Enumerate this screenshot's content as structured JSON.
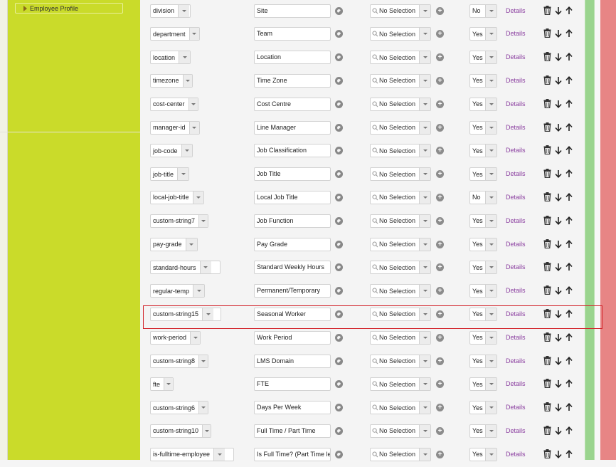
{
  "sidebar": {
    "profile_label": "Employee Profile"
  },
  "rows": [
    {
      "key": "division",
      "label": "Site",
      "picklist": "No Selection",
      "required": "No",
      "details": "Details"
    },
    {
      "key": "department",
      "label": "Team",
      "picklist": "No Selection",
      "required": "Yes",
      "details": "Details"
    },
    {
      "key": "location",
      "label": "Location",
      "picklist": "No Selection",
      "required": "Yes",
      "details": "Details"
    },
    {
      "key": "timezone",
      "label": "Time Zone",
      "picklist": "No Selection",
      "required": "Yes",
      "details": "Details"
    },
    {
      "key": "cost-center",
      "label": "Cost Centre",
      "picklist": "No Selection",
      "required": "Yes",
      "details": "Details"
    },
    {
      "key": "manager-id",
      "label": "Line Manager",
      "picklist": "No Selection",
      "required": "Yes",
      "details": "Details"
    },
    {
      "key": "job-code",
      "label": "Job Classification",
      "picklist": "No Selection",
      "required": "Yes",
      "details": "Details"
    },
    {
      "key": "job-title",
      "label": "Job Title",
      "picklist": "No Selection",
      "required": "Yes",
      "details": "Details"
    },
    {
      "key": "local-job-title",
      "label": "Local Job Title",
      "picklist": "No Selection",
      "required": "No",
      "details": "Details"
    },
    {
      "key": "custom-string7",
      "label": "Job Function",
      "picklist": "No Selection",
      "required": "Yes",
      "details": "Details"
    },
    {
      "key": "pay-grade",
      "label": "Pay Grade",
      "picklist": "No Selection",
      "required": "Yes",
      "details": "Details"
    },
    {
      "key": "standard-hours",
      "label": "Standard Weekly Hours",
      "picklist": "No Selection",
      "required": "Yes",
      "details": "Details"
    },
    {
      "key": "regular-temp",
      "label": "Permanent/Temporary",
      "picklist": "No Selection",
      "required": "Yes",
      "details": "Details"
    },
    {
      "key": "custom-string15",
      "label": "Seasonal Worker",
      "picklist": "No Selection",
      "required": "Yes",
      "details": "Details"
    },
    {
      "key": "work-period",
      "label": "Work Period",
      "picklist": "No Selection",
      "required": "Yes",
      "details": "Details"
    },
    {
      "key": "custom-string8",
      "label": "LMS Domain",
      "picklist": "No Selection",
      "required": "Yes",
      "details": "Details"
    },
    {
      "key": "fte",
      "label": "FTE",
      "picklist": "No Selection",
      "required": "Yes",
      "details": "Details"
    },
    {
      "key": "custom-string6",
      "label": "Days Per Week",
      "picklist": "No Selection",
      "required": "Yes",
      "details": "Details"
    },
    {
      "key": "custom-string10",
      "label": "Full Time / Part Time",
      "picklist": "No Selection",
      "required": "Yes",
      "details": "Details"
    },
    {
      "key": "is-fulltime-employee",
      "label": "Is Full Time? (Part Time les",
      "picklist": "No Selection",
      "required": "Yes",
      "details": "Details"
    }
  ],
  "icons": {
    "label_action": "globe-icon",
    "add_picklist": "plus-circle-icon",
    "delete": "trash-icon",
    "move_down": "arrow-down-icon",
    "move_up": "arrow-up-icon"
  },
  "highlight_row_key": "custom-string15",
  "colors": {
    "sidebar_lime": "#cadb2a",
    "details_link": "#8b3fa0",
    "highlight_border": "#d2232a",
    "green_column": "#9ad48e",
    "red_column": "#e78585"
  }
}
